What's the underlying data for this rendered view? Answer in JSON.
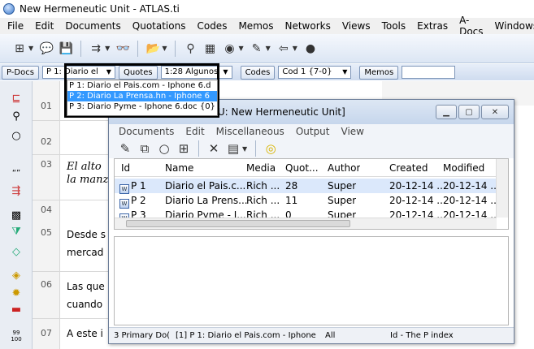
{
  "window": {
    "title": "New Hermeneutic Unit - ATLAS.ti"
  },
  "menubar": [
    "File",
    "Edit",
    "Documents",
    "Quotations",
    "Codes",
    "Memos",
    "Networks",
    "Views",
    "Tools",
    "Extras",
    "A-Docs",
    "Windows"
  ],
  "docbar": {
    "pdocs_label": "P-Docs",
    "pdoc_combo_value": "P 1: Diario el",
    "quotes_label": "Quotes",
    "quotes_combo_value": "1:28 Algunos",
    "codes_label": "Codes",
    "codes_combo_value": "Cod 1 {7-0}",
    "memos_label": "Memos"
  },
  "pdoc_dropdown": {
    "options": [
      "P 1: Diario el Pais.com - Iphone 6.d",
      "P 2: Diario La Prensa.hn - Iphone 6",
      "P 3: Diario Pyme - Iphone 6.doc {0}"
    ],
    "selected_index": 1
  },
  "document": {
    "line_numbers": [
      "01",
      "02",
      "03",
      "04",
      "05",
      "06",
      "07"
    ],
    "lines": {
      "l3a": "El alto",
      "l3b": "la manz",
      "l5": "Desde s",
      "l5b": "mercad",
      "l6": "Las que",
      "l6b": "cuando",
      "l7": "A este i"
    }
  },
  "hu_dialog": {
    "title": "er [HU: New Hermeneutic Unit]",
    "menu": [
      "Documents",
      "Edit",
      "Miscellaneous",
      "Output",
      "View"
    ],
    "table": {
      "headers": [
        "Id",
        "Name",
        "Media",
        "Quot...",
        "Author",
        "Created",
        "Modified"
      ],
      "rows": [
        [
          "P 1",
          "Diario el Pais.c...",
          "Rich ...",
          "28",
          "Super",
          "20-12-14 ...",
          "20-12-14 ..."
        ],
        [
          "P 2",
          "Diario La Prens...",
          "Rich ...",
          "11",
          "Super",
          "20-12-14 ...",
          "20-12-14 ..."
        ],
        [
          "P 3",
          "Diario Pyme - I...",
          "Rich ...",
          "0",
          "Super",
          "20-12-14 ...",
          "20-12-14 ..."
        ]
      ]
    },
    "status": {
      "count": "3 Primary Do(",
      "current": "[1] P 1: Diario el Pais.com - Iphone",
      "filter": "All",
      "sort": "Id - The P index"
    }
  },
  "side_icons": [
    "pdoc-link-icon",
    "search-icon",
    "comment-icon",
    "quote-icon",
    "code-icon",
    "network-icon",
    "filter-icon",
    "memo-icon",
    "zoom-percent-icon"
  ],
  "zoom_label": "99\n100"
}
